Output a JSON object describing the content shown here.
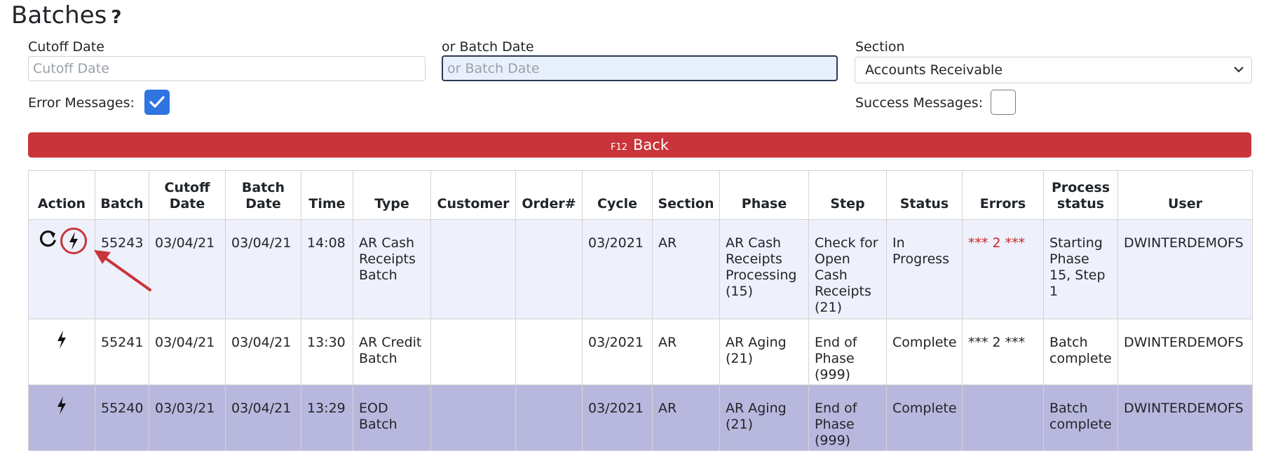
{
  "page": {
    "title": "Batches",
    "help_glyph": "?"
  },
  "filters": {
    "cutoff_label": "Cutoff Date",
    "cutoff_placeholder": "Cutoff Date",
    "cutoff_value": "",
    "batch_label": "or Batch Date",
    "batch_placeholder": "or Batch Date",
    "batch_value": "",
    "section_label": "Section",
    "section_value": "Accounts Receivable",
    "error_messages_label": "Error Messages:",
    "error_messages_checked": true,
    "success_messages_label": "Success Messages:",
    "success_messages_checked": false
  },
  "back_button": {
    "shortcut": "F12",
    "label": "Back",
    "color": "#c8343a"
  },
  "table": {
    "headers": {
      "action": "Action",
      "batch": "Batch",
      "cutoff_l1": "Cutoff",
      "cutoff_l2": "Date",
      "batchdate_l1": "Batch",
      "batchdate_l2": "Date",
      "time": "Time",
      "type": "Type",
      "customer": "Customer",
      "order": "Order#",
      "cycle": "Cycle",
      "section": "Section",
      "phase": "Phase",
      "step": "Step",
      "status": "Status",
      "errors": "Errors",
      "process_l1": "Process",
      "process_l2": "status",
      "user": "User"
    },
    "rows": [
      {
        "icons": [
          "refresh-icon",
          "lightning-icon"
        ],
        "batch": "55243",
        "cutoff": "03/04/21",
        "batch_date": "03/04/21",
        "time": "14:08",
        "type_l1": "AR Cash",
        "type_l2": "Receipts",
        "type_l3": "Batch",
        "customer": "",
        "order": "",
        "cycle": "03/2021",
        "section": "AR",
        "phase_l1": "AR Cash",
        "phase_l2": "Receipts",
        "phase_l3": "Processing",
        "phase_l4": "(15)",
        "step_l1": "Check for",
        "step_l2": "Open",
        "step_l3": "Cash",
        "step_l4": "Receipts",
        "step_l5": "(21)",
        "status_l1": "In",
        "status_l2": "Progress",
        "errors": "*** 2 ***",
        "process_l1": "Starting",
        "process_l2": "Phase",
        "process_l3": "15, Step",
        "process_l4": "1",
        "user": "DWINTERDEMOFS"
      },
      {
        "icons": [
          "lightning-icon"
        ],
        "batch": "55241",
        "cutoff": "03/04/21",
        "batch_date": "03/04/21",
        "time": "13:30",
        "type_l1": "AR Credit",
        "type_l2": "Batch",
        "customer": "",
        "order": "",
        "cycle": "03/2021",
        "section": "AR",
        "phase_l1": "AR Aging",
        "phase_l2": "(21)",
        "step_l1": "End of",
        "step_l2": "Phase",
        "step_l3": "(999)",
        "status_l1": "Complete",
        "errors": "*** 2 ***",
        "process_l1": "Batch",
        "process_l2": "complete",
        "user": "DWINTERDEMOFS"
      },
      {
        "icons": [
          "lightning-icon"
        ],
        "batch": "55240",
        "cutoff": "03/03/21",
        "batch_date": "03/04/21",
        "time": "13:29",
        "type_l1": "EOD",
        "type_l2": "Batch",
        "customer": "",
        "order": "",
        "cycle": "03/2021",
        "section": "AR",
        "phase_l1": "AR Aging",
        "phase_l2": "(21)",
        "step_l1": "End of",
        "step_l2": "Phase",
        "step_l3": "(999)",
        "status_l1": "Complete",
        "errors": "",
        "process_l1": "Batch",
        "process_l2": "complete",
        "user": "DWINTERDEMOFS"
      }
    ]
  },
  "colors": {
    "accent_blue": "#2f74e0",
    "error_red": "#c62828",
    "row_highlight": "#b8b8de",
    "annotation_red": "#c8343a"
  }
}
